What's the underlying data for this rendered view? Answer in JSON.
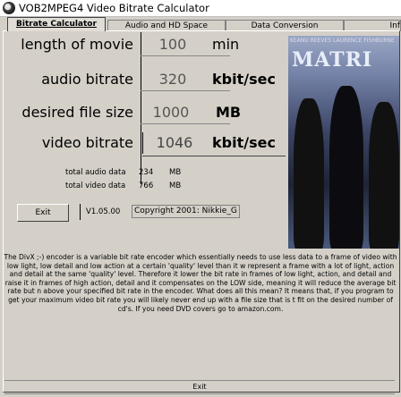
{
  "window": {
    "title": "VOB2MPEG4 Video Bitrate Calculator"
  },
  "tabs": [
    {
      "label": "Bitrate Calculator"
    },
    {
      "label": "Audio and HD Space"
    },
    {
      "label": "Data Conversion"
    },
    {
      "label": "Inf"
    }
  ],
  "form": {
    "length": {
      "label": "length of movie",
      "value": "100",
      "unit": "min"
    },
    "audio": {
      "label": "audio bitrate",
      "value": "320",
      "unit": "kbit/sec"
    },
    "size": {
      "label": "desired file size",
      "value": "1000",
      "unit": "MB"
    },
    "video": {
      "label": "video bitrate",
      "value": "1046",
      "unit": "kbit/sec"
    }
  },
  "totals": {
    "audio_label": "total audio data",
    "audio_value": "234",
    "audio_unit": "MB",
    "video_label": "total video data",
    "video_value": "766",
    "video_unit": "MB"
  },
  "footer": {
    "exit_label": "Exit",
    "version": "V1.05.00",
    "copyright": "Copyright 2001: Nikkie_G"
  },
  "poster": {
    "title": "MATRI",
    "credits": "KEANU REEVES  LAURENCE FISHBURNE"
  },
  "description": "The DivX ;-) encoder is a variable bit rate encoder which essentially needs to use less data to a frame of video with low light, low detail and low action at a certain 'quality' level than it w represent a frame with a lot of light, action and detail at the same 'quality' level. Therefore it lower the bit rate in frames of low light, action, and detail and raise it in frames of high action, detail and it compensates on the LOW side, meaning it will reduce the average bit rate but n above your specified bit rate in the encoder. What does all this mean? It means that, if you program to get your maximum video bit rate you will likely never end up with a file size that is t fit on the desired number of cd's. If you need DVD covers go to amazon.com.",
  "bottom": {
    "exit_label": "Exit"
  }
}
